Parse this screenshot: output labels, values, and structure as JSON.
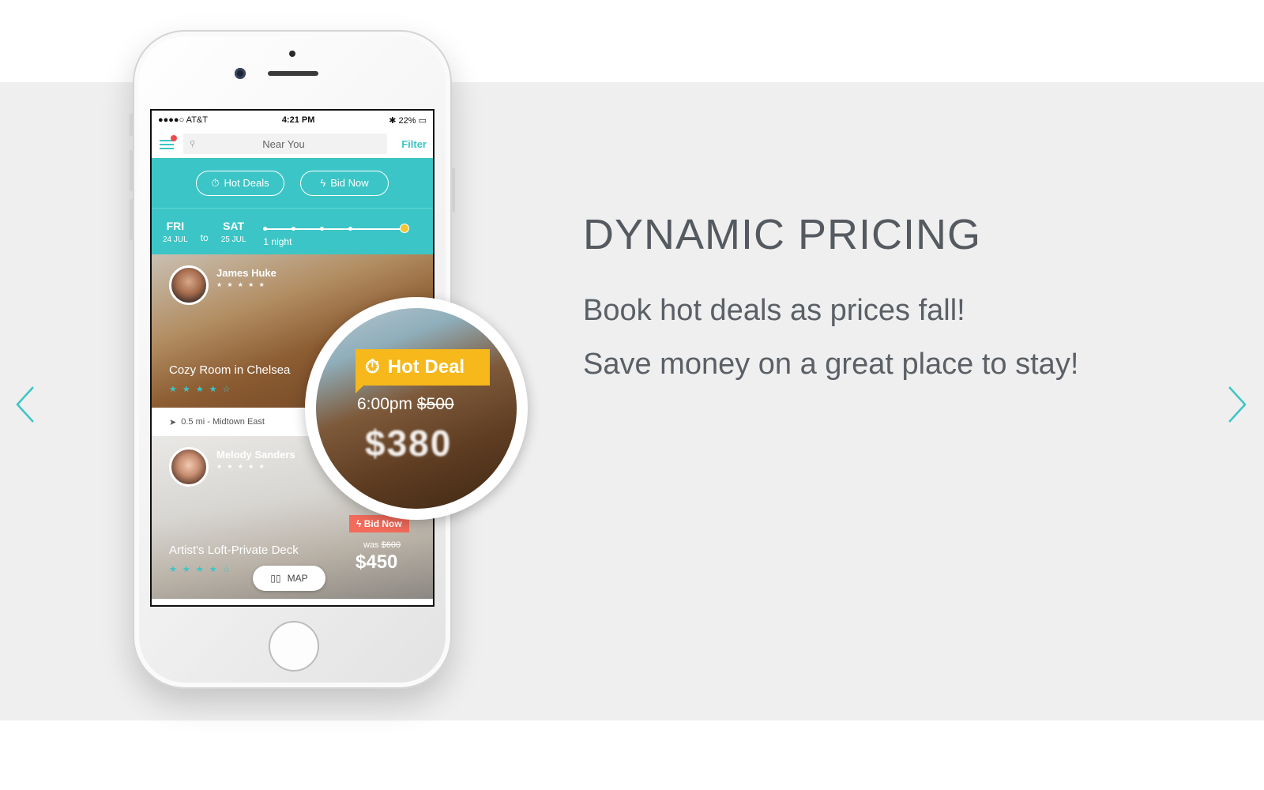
{
  "navigation": {
    "prev_icon": "chevron-left-icon",
    "next_icon": "chevron-right-icon",
    "accent": "#3cc5c6"
  },
  "content": {
    "heading": "DYNAMIC PRICING",
    "line1": "Book hot deals as prices fall!",
    "line2": "Save money on a great place to stay!"
  },
  "app": {
    "status": {
      "carrier": "●●●●○ AT&T",
      "time": "4:21 PM",
      "battery": "22%"
    },
    "search": {
      "placeholder": "Near You",
      "filter": "Filter"
    },
    "tabs": [
      {
        "label": "Hot Deals",
        "icon": "timer-icon"
      },
      {
        "label": "Bid Now",
        "icon": "lightning-icon"
      }
    ],
    "dates": {
      "from_day": "FRI",
      "from_date": "24 JUL",
      "to": "to",
      "to_day": "SAT",
      "to_date": "25 JUL",
      "nights": "1 night"
    },
    "listings": [
      {
        "host": "James Huke",
        "title": "Cozy Room in Chelsea",
        "stars": "★ ★ ★ ★ ☆",
        "location": "0.5 mi - Midtown East"
      },
      {
        "host": "Melody Sanders",
        "title": "Artist's Loft-Private Deck",
        "stars": "★ ★ ★ ★ ☆",
        "badge": "Bid Now",
        "was_label": "was",
        "was_price": "$600",
        "price": "$450"
      }
    ],
    "map_label": "MAP",
    "host_stars": "★ ★ ★ ★ ★"
  },
  "magnifier": {
    "badge": "Hot Deal",
    "time": "6:00pm",
    "old_price": "$500",
    "new_price": "$380"
  },
  "colors": {
    "teal": "#3cc5c6",
    "hot": "#f6b81a",
    "bid": "#f26b5b",
    "band": "#efefef"
  }
}
